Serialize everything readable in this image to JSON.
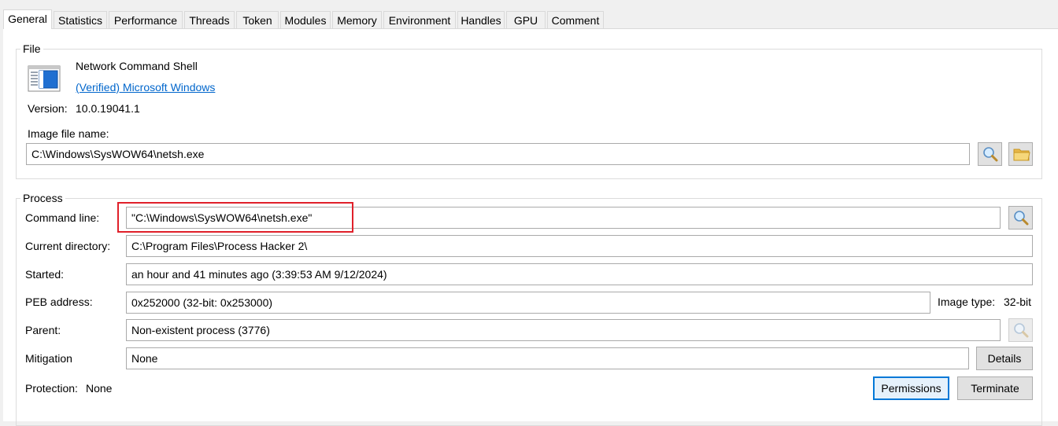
{
  "tabs": [
    "General",
    "Statistics",
    "Performance",
    "Threads",
    "Token",
    "Modules",
    "Memory",
    "Environment",
    "Handles",
    "GPU",
    "Comment"
  ],
  "file": {
    "group_title": "File",
    "description": "Network Command Shell",
    "verified_link": "(Verified) Microsoft Windows",
    "version_label": "Version:",
    "version_value": "10.0.19041.1",
    "image_file_label": "Image file name:",
    "image_file_value": "C:\\Windows\\SysWOW64\\netsh.exe"
  },
  "process": {
    "group_title": "Process",
    "command_line_label": "Command line:",
    "command_line_value": "\"C:\\Windows\\SysWOW64\\netsh.exe\"",
    "current_directory_label": "Current directory:",
    "current_directory_value": "C:\\Program Files\\Process Hacker 2\\",
    "started_label": "Started:",
    "started_value": "an hour and 41 minutes ago (3:39:53 AM 9/12/2024)",
    "peb_label": "PEB address:",
    "peb_value": "0x252000 (32-bit: 0x253000)",
    "image_type_label": "Image type:",
    "image_type_value": "32-bit",
    "parent_label": "Parent:",
    "parent_value": "Non-existent process (3776)",
    "mitigation_label": "Mitigation",
    "mitigation_value": "None",
    "details_button": "Details",
    "protection_label": "Protection:",
    "protection_value": "None",
    "permissions_button": "Permissions",
    "terminate_button": "Terminate"
  },
  "colors": {
    "highlight": "#e0202a",
    "link": "#0066cc",
    "default_button_border": "#0078d7"
  }
}
